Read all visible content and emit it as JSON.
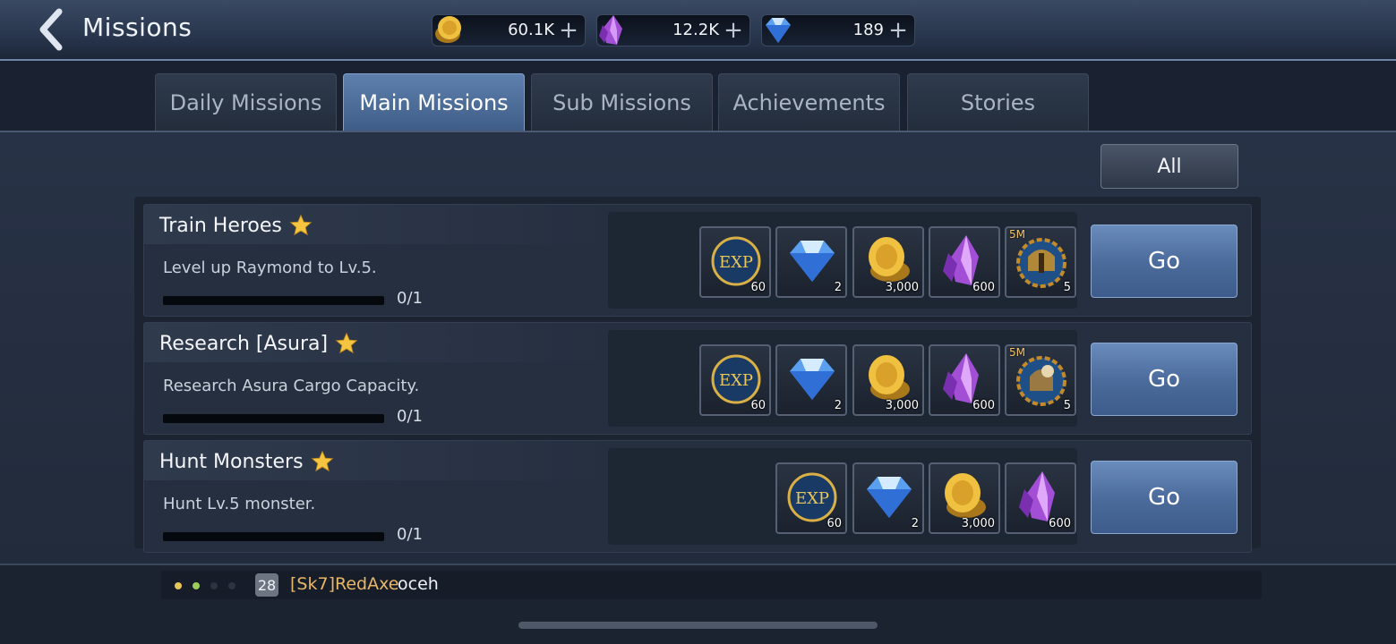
{
  "header": {
    "title": "Missions",
    "currencies": [
      {
        "name": "gold",
        "value": "60.1K",
        "icon": "gold-coin-icon"
      },
      {
        "name": "crystal",
        "value": "12.2K",
        "icon": "purple-crystal-icon"
      },
      {
        "name": "diamond",
        "value": "189",
        "icon": "diamond-icon"
      }
    ],
    "plus_symbol": "+"
  },
  "tabs": [
    {
      "label": "Daily Missions",
      "active": false
    },
    {
      "label": "Main Missions",
      "active": true
    },
    {
      "label": "Sub Missions",
      "active": false
    },
    {
      "label": "Achievements",
      "active": false
    },
    {
      "label": "Stories",
      "active": false
    }
  ],
  "filter": {
    "label": "All"
  },
  "missions": [
    {
      "title": "Train Heroes",
      "description": "Level up Raymond to Lv.5.",
      "progress": "0/1",
      "progress_fraction": 0,
      "rewards": [
        {
          "icon": "exp-icon",
          "count": "60"
        },
        {
          "icon": "diamond-icon",
          "count": "2"
        },
        {
          "icon": "gold-coin-icon",
          "count": "3,000"
        },
        {
          "icon": "purple-crystal-icon",
          "count": "600"
        },
        {
          "icon": "speedup-helmet-icon",
          "count": "5",
          "tag": "5M"
        }
      ],
      "button": "Go"
    },
    {
      "title": "Research [Asura]",
      "description": "Research Asura Cargo Capacity.",
      "progress": "0/1",
      "progress_fraction": 0,
      "rewards": [
        {
          "icon": "exp-icon",
          "count": "60"
        },
        {
          "icon": "diamond-icon",
          "count": "2"
        },
        {
          "icon": "gold-coin-icon",
          "count": "3,000"
        },
        {
          "icon": "purple-crystal-icon",
          "count": "600"
        },
        {
          "icon": "speedup-research-icon",
          "count": "5",
          "tag": "5M"
        }
      ],
      "button": "Go"
    },
    {
      "title": "Hunt Monsters",
      "description": "Hunt Lv.5 monster.",
      "progress": "0/1",
      "progress_fraction": 0,
      "rewards": [
        {
          "icon": "exp-icon",
          "count": "60"
        },
        {
          "icon": "diamond-icon",
          "count": "2"
        },
        {
          "icon": "gold-coin-icon",
          "count": "3,000"
        },
        {
          "icon": "purple-crystal-icon",
          "count": "600"
        }
      ],
      "button": "Go"
    }
  ],
  "chat": {
    "level": "28",
    "name": "[Sk7]RedAxe",
    "message": "oceh"
  },
  "colors": {
    "accent": "#4b6c9c",
    "chat_name": "#e8b766",
    "star": "#f5c542"
  }
}
